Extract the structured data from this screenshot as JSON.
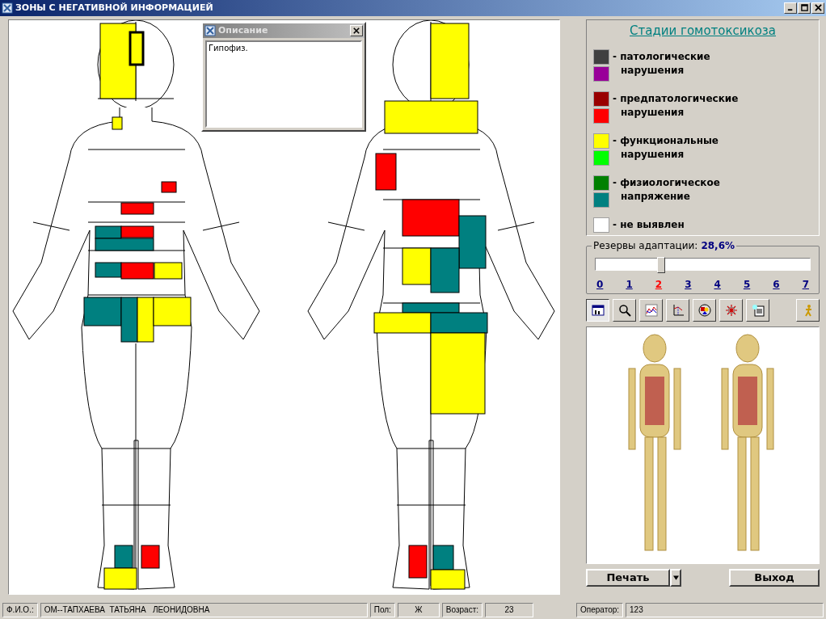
{
  "window": {
    "title": "ЗОНЫ С НЕГАТИВНОЙ ИНФОРМАЦИЕЙ"
  },
  "body_map": {
    "front_zones": [
      {
        "color": "#ffff00"
      },
      {
        "color": "#ffff00"
      },
      {
        "color": "#ffff00"
      },
      {
        "color": "#ff0000"
      },
      {
        "color": "#ff0000"
      },
      {
        "color": "#008080"
      },
      {
        "color": "#ff0000"
      },
      {
        "color": "#008080"
      },
      {
        "color": "#008080"
      },
      {
        "color": "#ff0000"
      },
      {
        "color": "#ffff00"
      },
      {
        "color": "#008080"
      },
      {
        "color": "#008080"
      },
      {
        "color": "#ffff00"
      },
      {
        "color": "#ffff00"
      },
      {
        "color": "#008080"
      },
      {
        "color": "#ff0000"
      },
      {
        "color": "#ffff00"
      }
    ],
    "back_zones": [
      {
        "color": "#ffff00"
      },
      {
        "color": "#ffff00"
      },
      {
        "color": "#ff0000"
      },
      {
        "color": "#ff0000"
      },
      {
        "color": "#008080"
      },
      {
        "color": "#ffff00"
      },
      {
        "color": "#008080"
      },
      {
        "color": "#008080"
      },
      {
        "color": "#ffff00"
      },
      {
        "color": "#008080"
      },
      {
        "color": "#ffff00"
      },
      {
        "color": "#ff0000"
      },
      {
        "color": "#008080"
      },
      {
        "color": "#ffff00"
      }
    ]
  },
  "description_popup": {
    "title": "Описание",
    "text": "Гипофиз."
  },
  "legend": {
    "title": "Стадии гомотоксикоза",
    "items": [
      {
        "label": "- патологические",
        "label_2": "нарушения",
        "swatches": [
          {
            "color": "#404040"
          },
          {
            "color": "#990099"
          }
        ]
      },
      {
        "label": "- предпатологические",
        "label_2": "нарушения",
        "swatches": [
          {
            "color": "#990000"
          },
          {
            "color": "#ff0000"
          }
        ]
      },
      {
        "label": "- функциональные",
        "label_2": "нарушения",
        "swatches": [
          {
            "color": "#ffff00"
          },
          {
            "color": "#00ff00"
          }
        ]
      },
      {
        "label": "- физиологическое",
        "label_2": "напряжение",
        "swatches": [
          {
            "color": "#008000"
          },
          {
            "color": "#008080"
          }
        ]
      },
      {
        "label": "- не выявлен",
        "swatches": [
          {
            "color": "#ffffff"
          }
        ]
      }
    ]
  },
  "adaptation": {
    "label": "Резервы адаптации:",
    "value": "28,6%",
    "level": 0.3,
    "scale": [
      {
        "label": "0",
        "selected": false
      },
      {
        "label": "1",
        "selected": false
      },
      {
        "label": "2",
        "selected": true
      },
      {
        "label": "3",
        "selected": false
      },
      {
        "label": "4",
        "selected": false
      },
      {
        "label": "5",
        "selected": false
      },
      {
        "label": "6",
        "selected": false
      },
      {
        "label": "7",
        "selected": false
      }
    ]
  },
  "toolbar": [
    {
      "kind": "table",
      "selected": true
    },
    {
      "kind": "search",
      "selected": false
    },
    {
      "kind": "chart",
      "selected": false
    },
    {
      "kind": "axes",
      "selected": false
    },
    {
      "kind": "circle",
      "selected": false
    },
    {
      "kind": "star",
      "selected": false
    },
    {
      "kind": "doc",
      "selected": false
    },
    {
      "kind": "figure",
      "selected": false
    }
  ],
  "buttons": {
    "print": "Печать",
    "exit": "Выход"
  },
  "status_bar": [
    {
      "label": "Ф.И.О.:",
      "value": "ОМ--ТАПХАЕВА  ТАТЬЯНА   ЛЕОНИДОВНА",
      "kind": "wide"
    },
    {
      "label": "Пол:",
      "value": "Ж",
      "kind": "narrow"
    },
    {
      "label": "Возраст:",
      "value": "23",
      "kind": "mid"
    },
    {
      "label": "Оператор:",
      "value": "123",
      "kind": "last"
    }
  ]
}
